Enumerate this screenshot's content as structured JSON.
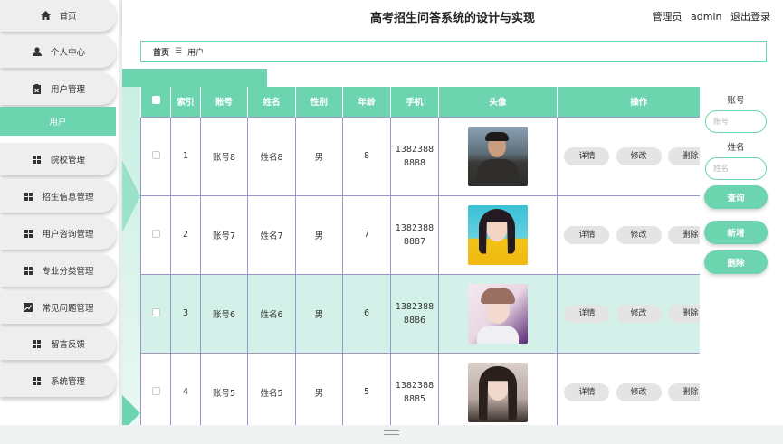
{
  "header": {
    "title": "高考招生问答系统的设计与实现",
    "role_label": "管理员",
    "username": "admin",
    "logout": "退出登录"
  },
  "sidebar": {
    "items": [
      {
        "label": "首页",
        "icon": "home-icon"
      },
      {
        "label": "个人中心",
        "icon": "user-icon"
      },
      {
        "label": "用户管理",
        "icon": "clipboard-icon"
      },
      {
        "label": "用户",
        "icon": "",
        "active": true
      },
      {
        "label": "院校管理",
        "icon": "grid-icon"
      },
      {
        "label": "招生信息管理",
        "icon": "grid-icon"
      },
      {
        "label": "用户咨询管理",
        "icon": "grid-icon"
      },
      {
        "label": "专业分类管理",
        "icon": "grid-icon"
      },
      {
        "label": "常见问题管理",
        "icon": "chart-icon"
      },
      {
        "label": "留言反馈",
        "icon": "grid-icon"
      },
      {
        "label": "系统管理",
        "icon": "grid-icon"
      }
    ]
  },
  "breadcrumb": {
    "home": "首页",
    "separator": "☰",
    "current": "用户"
  },
  "table": {
    "columns": [
      "索引",
      "账号",
      "姓名",
      "性别",
      "年龄",
      "手机",
      "头像",
      "操作"
    ],
    "rows": [
      {
        "index": "1",
        "account": "账号8",
        "name": "姓名8",
        "gender": "男",
        "age": "8",
        "phone1": "1382388",
        "phone2": "8888"
      },
      {
        "index": "2",
        "account": "账号7",
        "name": "姓名7",
        "gender": "男",
        "age": "7",
        "phone1": "1382388",
        "phone2": "8887"
      },
      {
        "index": "3",
        "account": "账号6",
        "name": "姓名6",
        "gender": "男",
        "age": "6",
        "phone1": "1382388",
        "phone2": "8886"
      },
      {
        "index": "4",
        "account": "账号5",
        "name": "姓名5",
        "gender": "男",
        "age": "5",
        "phone1": "1382388",
        "phone2": "8885"
      }
    ],
    "actions": {
      "detail": "详情",
      "edit": "修改",
      "delete": "删除"
    }
  },
  "search": {
    "account_label": "账号",
    "account_placeholder": "账号",
    "name_label": "姓名",
    "name_placeholder": "姓名",
    "query_button": "查询",
    "add_button": "新增",
    "delete_button": "删除"
  },
  "colors": {
    "accent": "#6dd4b0",
    "highlight_row": "#d3f1e8",
    "grid_line": "#9b97c9"
  }
}
